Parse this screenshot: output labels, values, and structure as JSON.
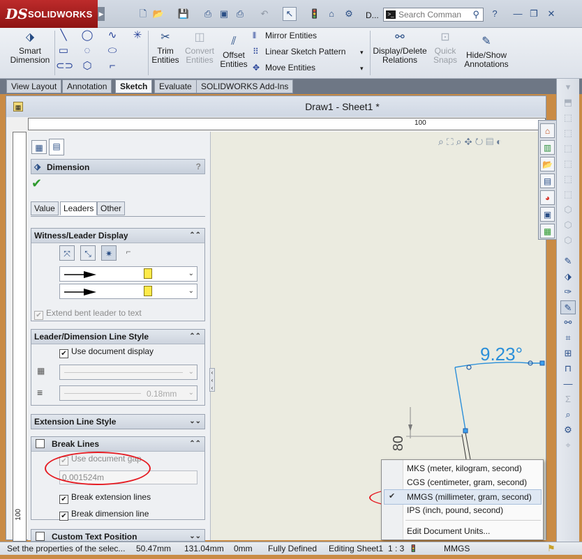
{
  "app": {
    "brand": "SOLIDWORKS",
    "window_title": "D..."
  },
  "search": {
    "placeholder": "Search Comman"
  },
  "ribbon": {
    "smart_dimension": "Smart Dimension",
    "trim": "Trim Entities",
    "convert": "Convert Entities",
    "offset": "Offset Entities",
    "mirror": "Mirror Entities",
    "linear_pattern": "Linear Sketch Pattern",
    "move": "Move Entities",
    "display_delete": "Display/Delete Relations",
    "quick_snaps": "Quick Snaps",
    "hide_show": "Hide/Show Annotations"
  },
  "tabs": [
    "View Layout",
    "Annotation",
    "Sketch",
    "Evaluate",
    "SOLIDWORKS Add-Ins"
  ],
  "active_tab": "Sketch",
  "document": {
    "title": "Draw1 - Sheet1 *",
    "ruler_top_mark": "100",
    "ruler_left_mark": "100"
  },
  "property_manager": {
    "title": "Dimension",
    "subtabs": [
      "Value",
      "Leaders",
      "Other"
    ],
    "active_subtab": "Leaders",
    "witness": {
      "header": "Witness/Leader Display",
      "extend_label": "Extend bent leader to text",
      "extend_checked": true
    },
    "leader_style": {
      "header": "Leader/Dimension Line Style",
      "use_doc_label": "Use document display",
      "use_doc_checked": true,
      "thickness": "0.18mm"
    },
    "extension": {
      "header": "Extension Line Style"
    },
    "break_lines": {
      "header": "Break Lines",
      "use_doc_gap_label": "Use document gap",
      "gap_value": "0.001524m",
      "break_ext_label": "Break extension lines",
      "break_dim_label": "Break dimension line"
    },
    "custom_text": {
      "header": "Custom Text Position"
    }
  },
  "canvas": {
    "angle_dim": "9.23°",
    "linear_dim": "80"
  },
  "units_menu": {
    "items": [
      "MKS (meter, kilogram, second)",
      "CGS (centimeter, gram, second)",
      "MMGS (millimeter, gram, second)",
      "IPS (inch, pound, second)"
    ],
    "selected_index": 2,
    "edit": "Edit Document Units..."
  },
  "status": {
    "message": "Set the properties of the selec...",
    "x": "50.47mm",
    "y": "131.04mm",
    "z": "0mm",
    "state": "Fully Defined",
    "editing": "Editing Sheet1",
    "scale": "1 : 3",
    "units": "MMGS"
  },
  "colors": {
    "highlight": "#e51c23",
    "dimension": "#2b8fd9",
    "brand_red": "#b22222"
  }
}
